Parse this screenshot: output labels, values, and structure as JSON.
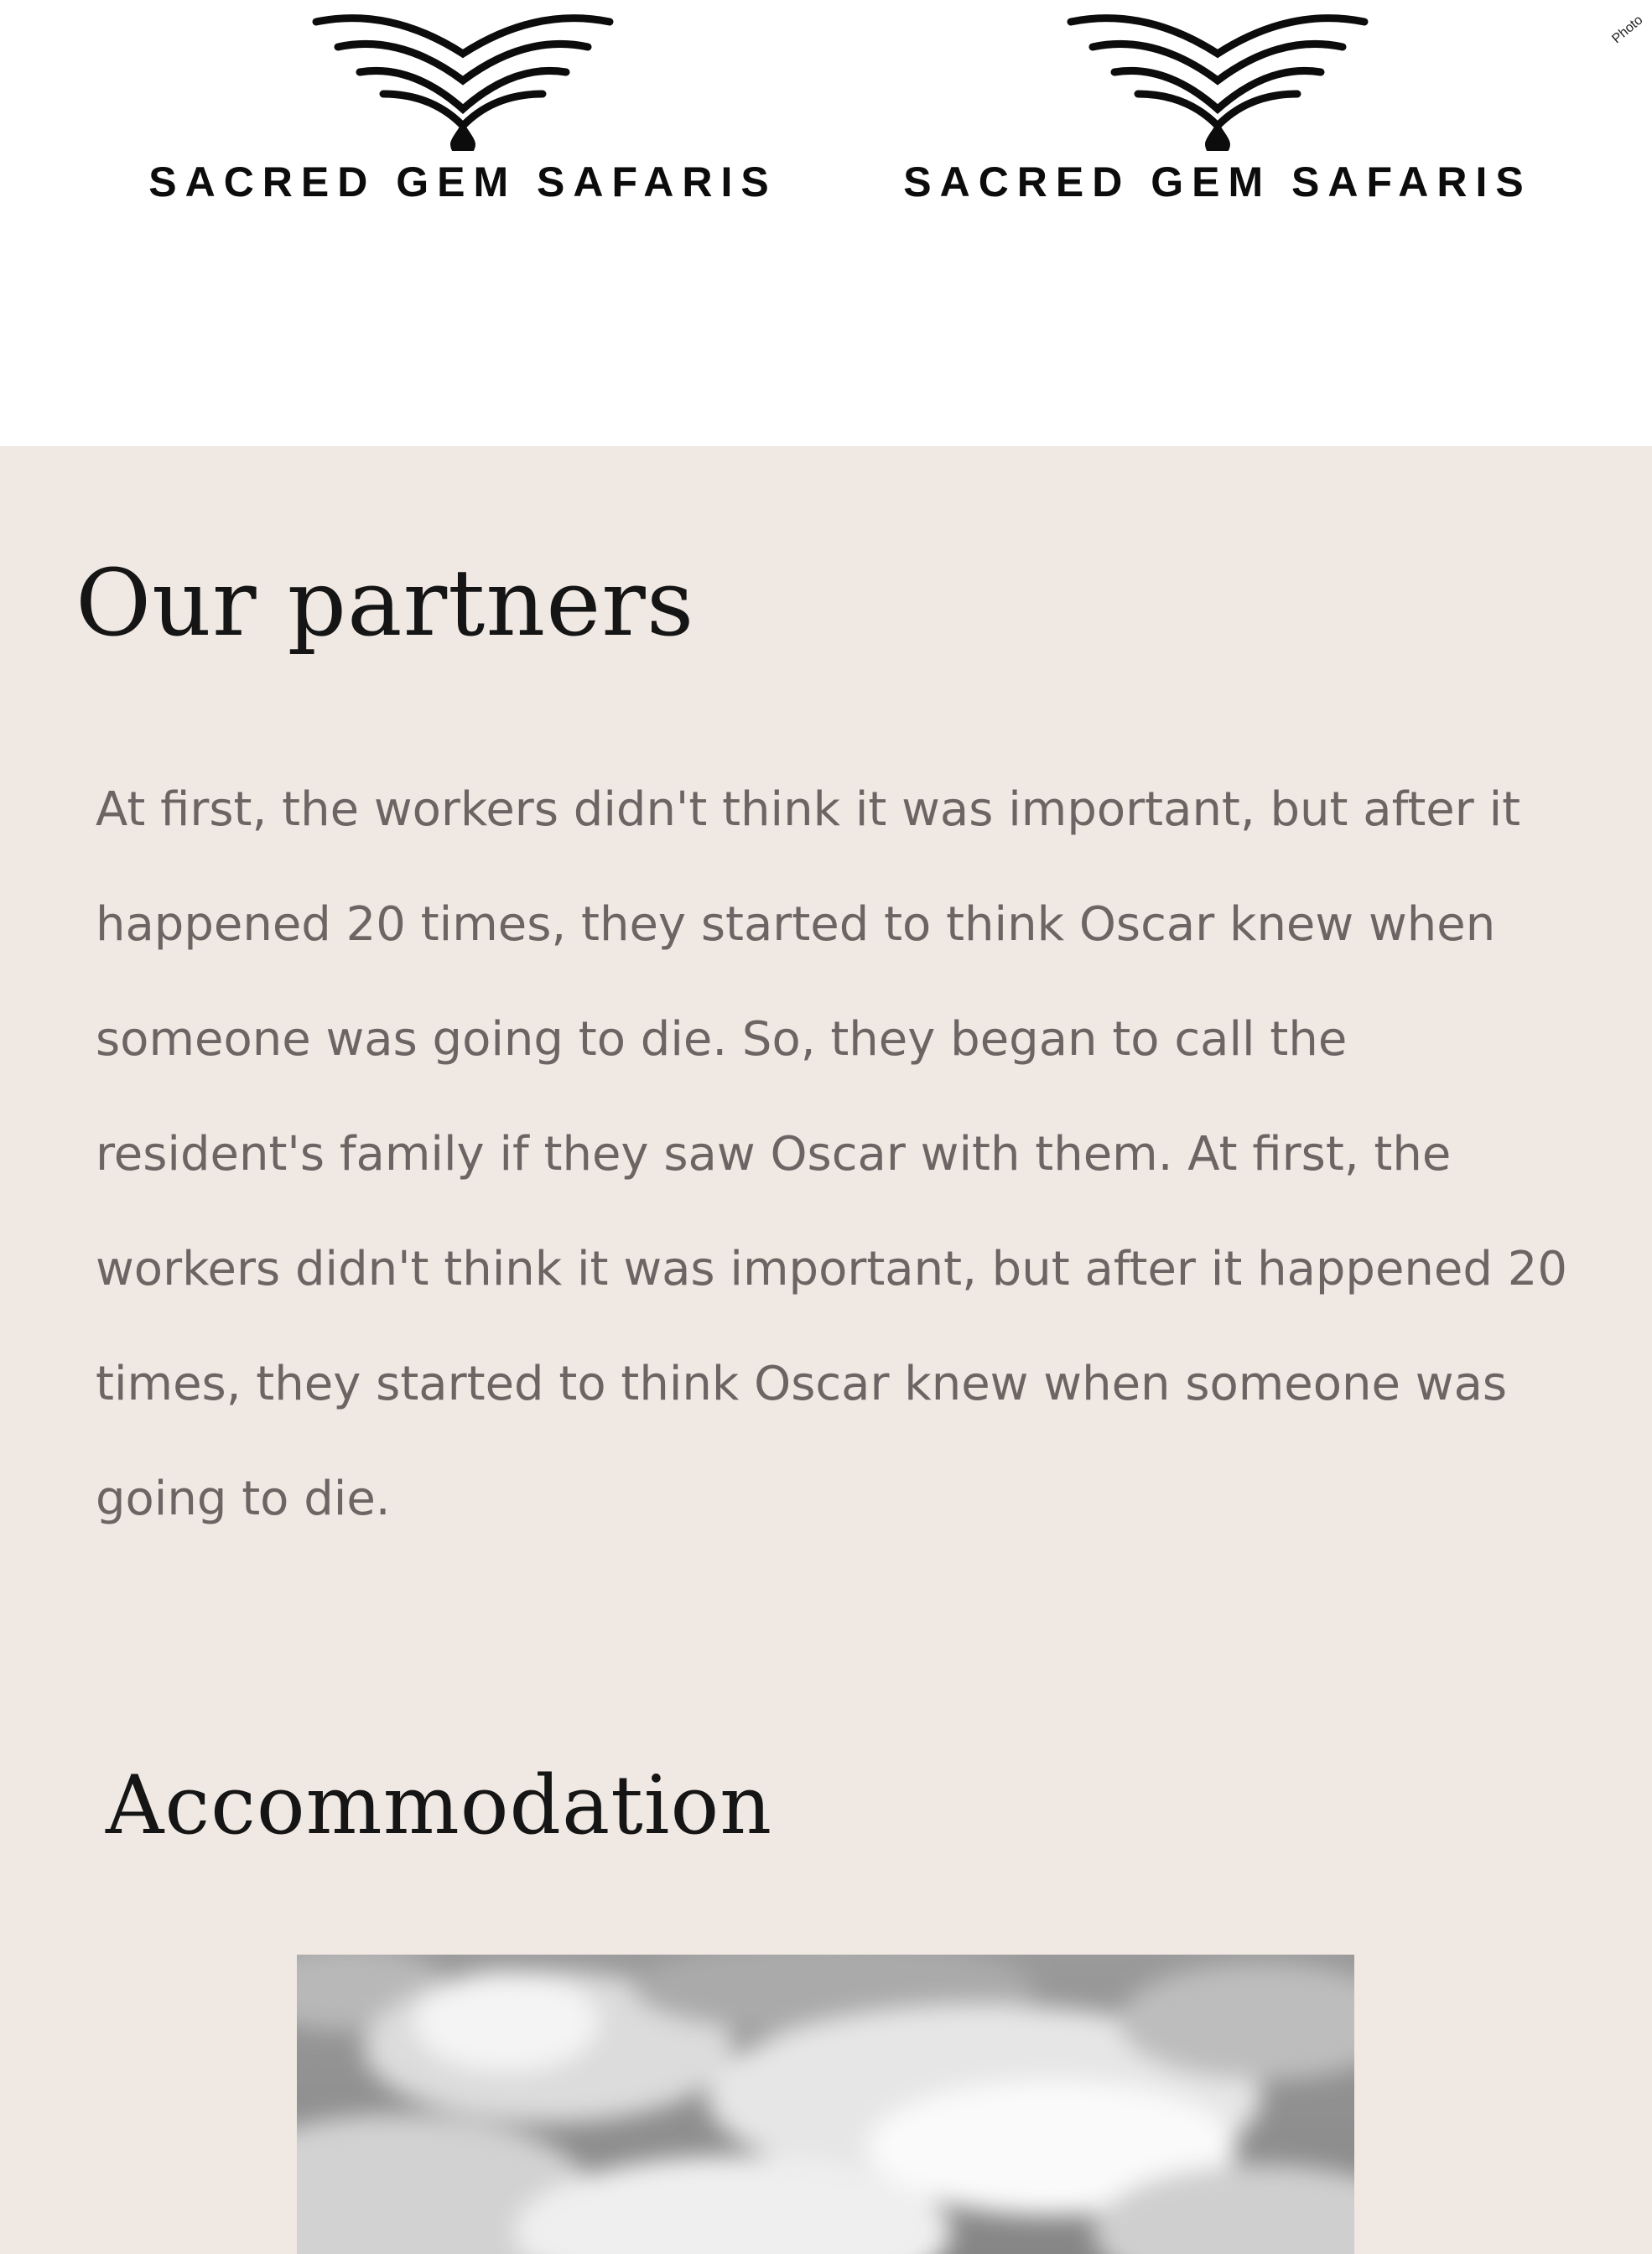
{
  "header": {
    "logos": [
      {
        "wordmark": "SACRED GEM SAFARIS",
        "icon": "wings-drop-logo-icon"
      },
      {
        "wordmark": "SACRED GEM SAFARIS",
        "icon": "wings-drop-logo-icon"
      }
    ],
    "corner_credit": "Photo"
  },
  "partners": {
    "heading": "Our partners",
    "body": "At first, the workers didn't think it was important, but after it happened 20 times, they started to think Oscar knew when someone was going to die. So, they began to call the resident's family if they saw Oscar with them. At first, the workers didn't think it was important, but after it happened 20 times, they started to think Oscar knew when someone was going to die."
  },
  "accommodation": {
    "heading": "Accommodation",
    "image": "cloudy-sky-photo"
  },
  "colors": {
    "panel_background": "#efe8e3",
    "heading_text": "#151515",
    "body_text": "#6b6664",
    "logo_ink": "#0c0c0c"
  }
}
